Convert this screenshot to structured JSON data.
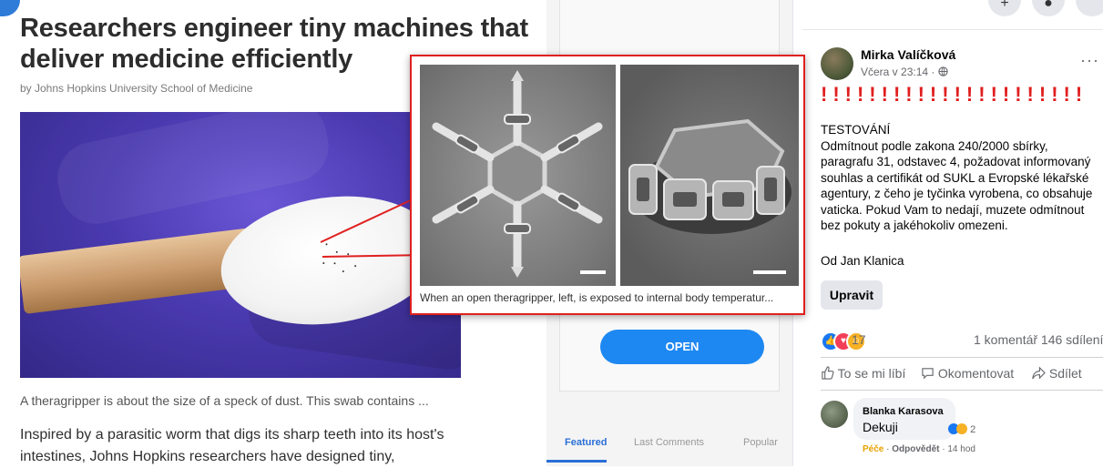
{
  "article": {
    "headline": "Researchers engineer tiny machines that deliver medicine efficiently",
    "byline": "by Johns Hopkins University School of Medicine",
    "image_caption": "A theragripper is about the size of a speck of dust. This swab contains ...",
    "body": "Inspired by a parasitic worm that digs its sharp teeth into its host's intestines, Johns Hopkins researchers have designed tiny,"
  },
  "zoom": {
    "caption": "When an open theragripper, left, is exposed to internal body temperatur..."
  },
  "middle": {
    "open_button": "OPEN",
    "tabs": [
      {
        "label": "Featured",
        "active": true
      },
      {
        "label": "Last Comments",
        "active": false
      },
      {
        "label": "Popular",
        "active": false
      }
    ]
  },
  "post": {
    "author": "Mirka Valíčková",
    "time": "Včera v 23:14 · ",
    "exclaim": "!!!!!!!!!!!!!!!!!!!!!!",
    "lines": [
      "TESTOVÁNÍ",
      "Odmítnout podle zakona 240/2000 sbírky,",
      "paragrafu 31, odstavec 4, požadovat informovaný",
      "souhlas a certifikát od SUKL a Evropské lékařské",
      "agentury, z čeho je tyčinka vyrobena, co obsahuje",
      "vaticka. Pokud Vam to nedají, muzete odmítnout",
      "bez pokuty a jakéhokoliv omezeni."
    ],
    "from": "Od Jan Klanica",
    "edit_label": "Upravit",
    "reaction_count": "17",
    "comments_shares": "1 komentář  146 sdílení",
    "actions": {
      "like": "To se mi líbí",
      "comment": "Okomentovat",
      "share": "Sdílet"
    },
    "comment": {
      "author": "Blanka Karasova",
      "text": "Dekuji",
      "reaction_count": "2",
      "care": "Péče",
      "reply": "Odpovědět",
      "age": "14 hod"
    }
  },
  "colors": {
    "accent_red": "#e02020",
    "fb_blue": "#1877f2",
    "open_button": "#1e88f2",
    "tab_active": "#2a6fd6"
  }
}
